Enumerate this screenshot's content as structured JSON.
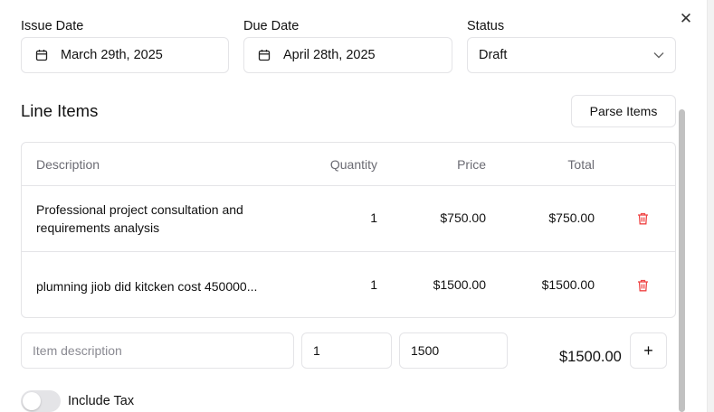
{
  "form": {
    "issue_date": {
      "label": "Issue Date",
      "value": "March 29th, 2025",
      "icon": "calendar-icon"
    },
    "due_date": {
      "label": "Due Date",
      "value": "April 28th, 2025",
      "icon": "calendar-icon"
    },
    "status": {
      "label": "Status",
      "value": "Draft",
      "icon": "chevron-down-icon"
    }
  },
  "line_items": {
    "title": "Line Items",
    "parse_button": "Parse Items",
    "columns": {
      "description": "Description",
      "quantity": "Quantity",
      "price": "Price",
      "total": "Total"
    },
    "rows": [
      {
        "description": "Professional project consultation and requirements analysis",
        "quantity": "1",
        "price": "$750.00",
        "total": "$750.00"
      },
      {
        "description": "plumning jiob did kitcken cost 450000...",
        "quantity": "1",
        "price": "$1500.00",
        "total": "$1500.00"
      }
    ],
    "delete_color": "#ef4444"
  },
  "new_item": {
    "description_placeholder": "Item description",
    "quantity": "1",
    "price": "1500",
    "total": "$1500.00",
    "add_label": "+"
  },
  "tax": {
    "label": "Include Tax",
    "enabled": false
  },
  "close_label": "✕"
}
